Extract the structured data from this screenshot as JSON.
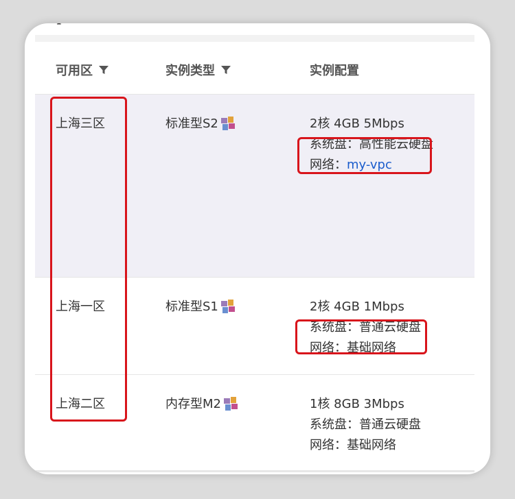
{
  "partial_text": "vpc",
  "columns": {
    "zone": "可用区",
    "instance_type": "实例类型",
    "config": "实例配置"
  },
  "rows": [
    {
      "zone": "上海三区",
      "instance_type": "标准型S2",
      "config_line1": "2核 4GB 5Mbps",
      "config_line2": "系统盘：高性能云硬盘",
      "network_label": "网络：",
      "network_value": "my-vpc",
      "network_is_link": true
    },
    {
      "zone": "上海一区",
      "instance_type": "标准型S1",
      "config_line1": "2核 4GB 1Mbps",
      "config_line2": "系统盘：普通云硬盘",
      "network_label": "网络：",
      "network_value": "基础网络",
      "network_is_link": false
    },
    {
      "zone": "上海二区",
      "instance_type": "内存型M2",
      "config_line1": "1核 8GB 3Mbps",
      "config_line2": "系统盘：普通云硬盘",
      "network_label": "网络：",
      "network_value": "基础网络",
      "network_is_link": false
    }
  ],
  "colors": {
    "highlight_box": "#d8141b",
    "link": "#1a5ccc",
    "selected_row_bg": "#f0eff6"
  }
}
